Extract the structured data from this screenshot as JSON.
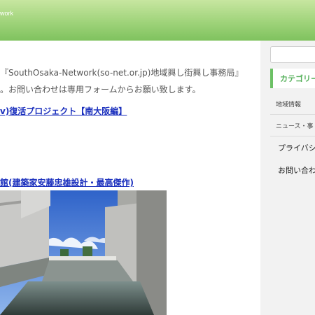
{
  "header": {
    "brand": "work"
  },
  "main": {
    "intro_line1": "『SouthOsaka-Network(so-net.or.jp)地域興し街興し事務局』",
    "intro_line2": "。お問い合わせは専用フォームからお願い致します。",
    "link1": "v)復活プロジェクト【南大阪編】",
    "link2": "館(建築家安藤忠雄設計・最高傑作)"
  },
  "sidebar": {
    "category_title": "カテゴリー",
    "items": [
      "地域情報",
      "ニュース・事"
    ],
    "privacy": "プライバシ",
    "contact": "お問い合わ"
  }
}
